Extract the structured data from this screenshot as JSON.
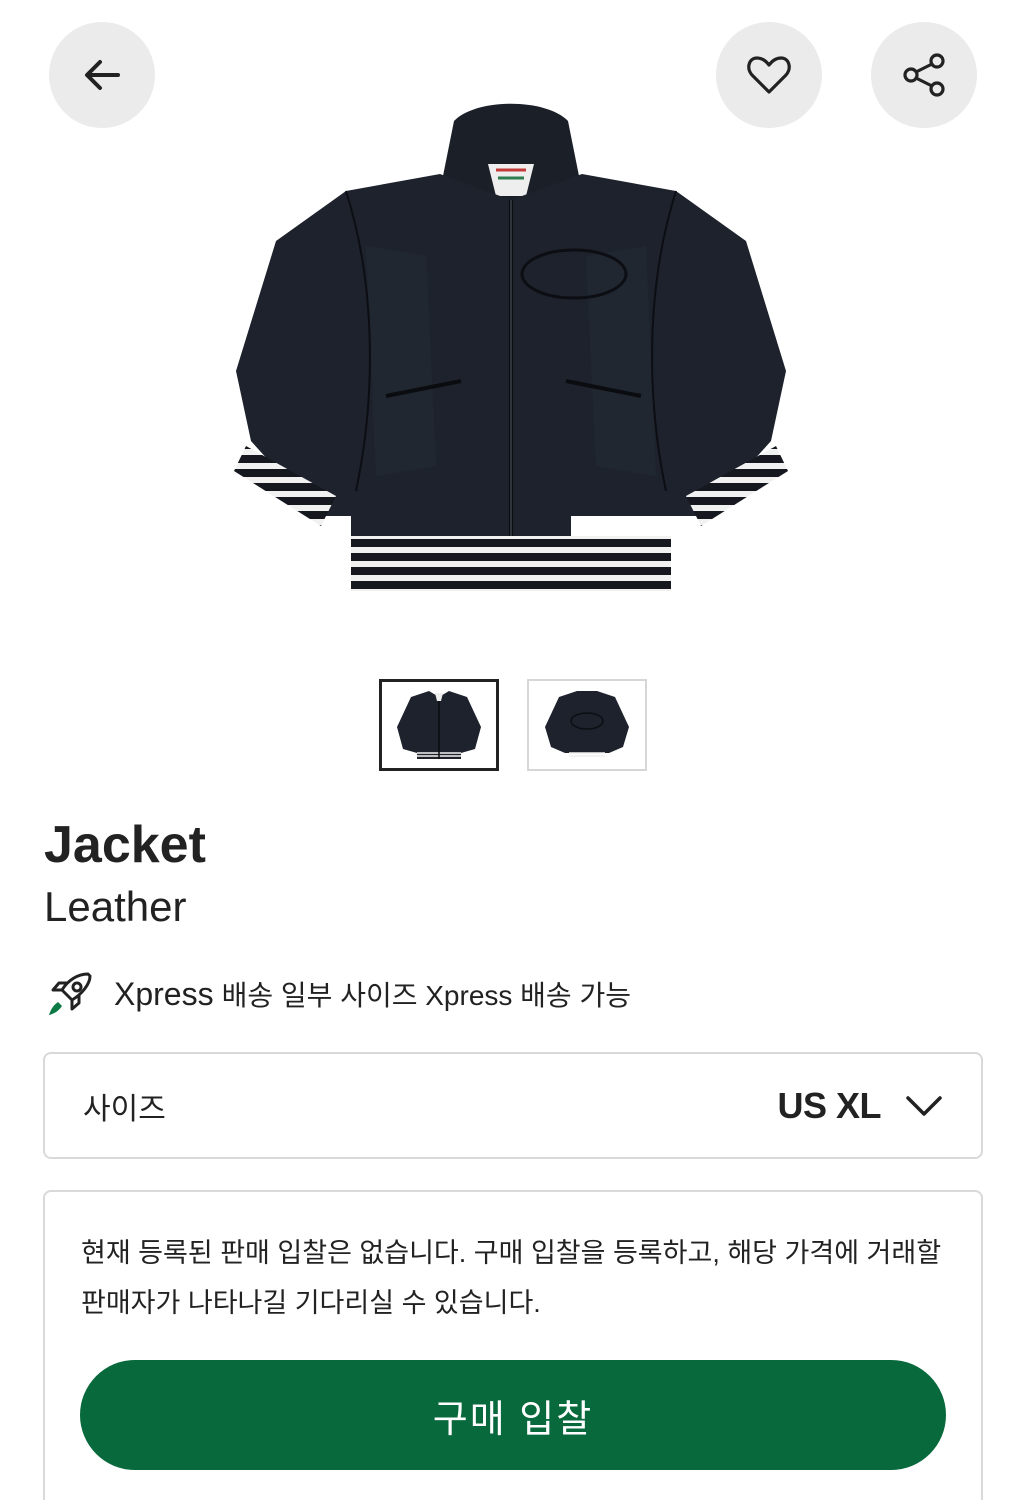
{
  "header": {
    "back_icon": "arrow-left-icon",
    "wishlist_icon": "heart-icon",
    "share_icon": "share-icon"
  },
  "gallery": {
    "thumbnails": [
      {
        "label": "front",
        "active": true
      },
      {
        "label": "back",
        "active": false
      }
    ]
  },
  "product": {
    "title": "Jacket",
    "subtitle": "Leather"
  },
  "express": {
    "icon": "rocket-icon",
    "brand": "Xpress",
    "text": "배송  일부 사이즈 Xpress 배송 가능"
  },
  "size_selector": {
    "label": "사이즈",
    "value": "US XL"
  },
  "bid_info": {
    "message": "현재 등록된 판매 입찰은 없습니다. 구매 입찰을 등록하고, 해당 가격에 거래할 판매자가 나타나길 기다리실 수 있습니다.",
    "button_label": "구매 입찰"
  },
  "colors": {
    "primary_green": "#08693d",
    "button_bg": "#ebebeb"
  }
}
